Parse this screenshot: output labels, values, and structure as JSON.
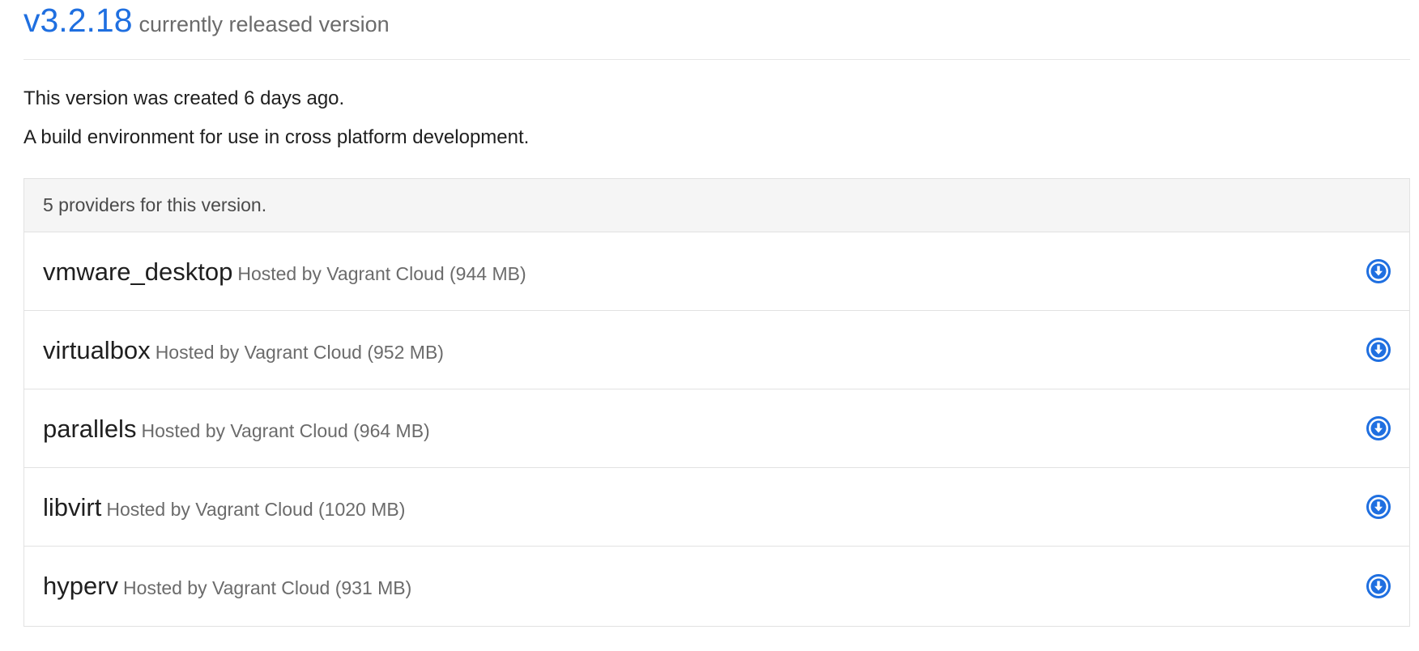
{
  "version": {
    "number": "v3.2.18",
    "status": "currently released version",
    "created": "This version was created 6 days ago.",
    "description": "A build environment for use in cross platform development."
  },
  "providers": {
    "heading": "5 providers for this version.",
    "items": [
      {
        "name": "vmware_desktop",
        "host": "Hosted by Vagrant Cloud (944 MB)",
        "icon": "download-circle-icon"
      },
      {
        "name": "virtualbox",
        "host": "Hosted by Vagrant Cloud (952 MB)",
        "icon": "download-circle-icon"
      },
      {
        "name": "parallels",
        "host": "Hosted by Vagrant Cloud (964 MB)",
        "icon": "download-circle-icon"
      },
      {
        "name": "libvirt",
        "host": "Hosted by Vagrant Cloud (1020 MB)",
        "icon": "download-circle-icon"
      },
      {
        "name": "hyperv",
        "host": "Hosted by Vagrant Cloud (931 MB)",
        "icon": "download-circle-icon"
      }
    ]
  },
  "colors": {
    "accent": "#1f6fe0",
    "muted_text": "#6b6b6b",
    "panel_heading_bg": "#f5f5f5",
    "border": "#e2e2e2"
  }
}
